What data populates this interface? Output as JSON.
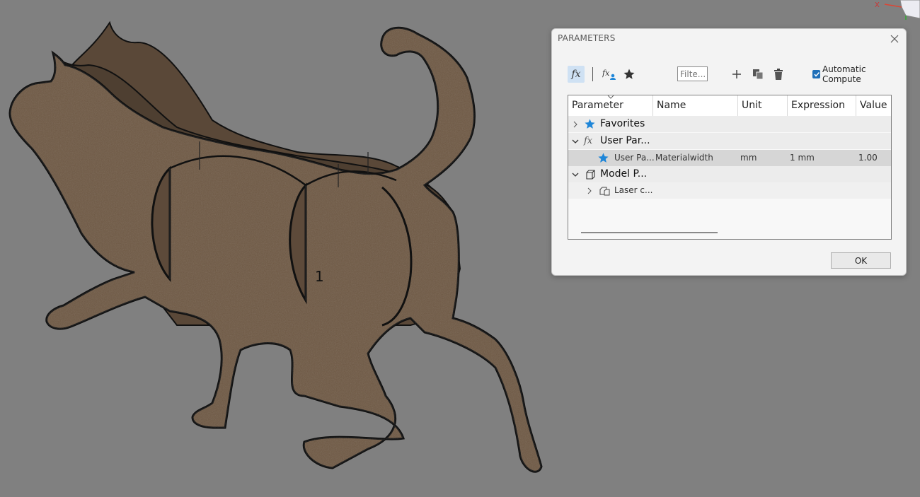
{
  "viewport": {
    "label_number": "1",
    "material_color": "#6e5843",
    "background_color": "#808080",
    "viewcube_axis": "X"
  },
  "dialog": {
    "title": "PARAMETERS",
    "toolbar": {
      "filter_placeholder": "Filte...",
      "auto_compute_label": "Automatic Compute",
      "auto_compute_checked": true,
      "icons": [
        "fx-icon",
        "user-fx-icon",
        "star-icon",
        "plus-icon",
        "copy-icon",
        "trash-icon"
      ]
    },
    "columns": [
      "Parameter",
      "Name",
      "Unit",
      "Expression",
      "Value"
    ],
    "rows": {
      "favorites": {
        "label": "Favorites",
        "expanded": false
      },
      "user_params": {
        "label": "User Par...",
        "expanded": true
      },
      "user_param_row": {
        "parameter": "User Pa...",
        "name": "Materialwidth",
        "unit": "mm",
        "expression": "1 mm",
        "value": "1.00"
      },
      "model_params": {
        "label": "Model P...",
        "expanded": true
      },
      "laser_row": {
        "label": "Laser c...",
        "expanded": false
      }
    },
    "ok_label": "OK",
    "accent_color": "#1f86d8"
  }
}
